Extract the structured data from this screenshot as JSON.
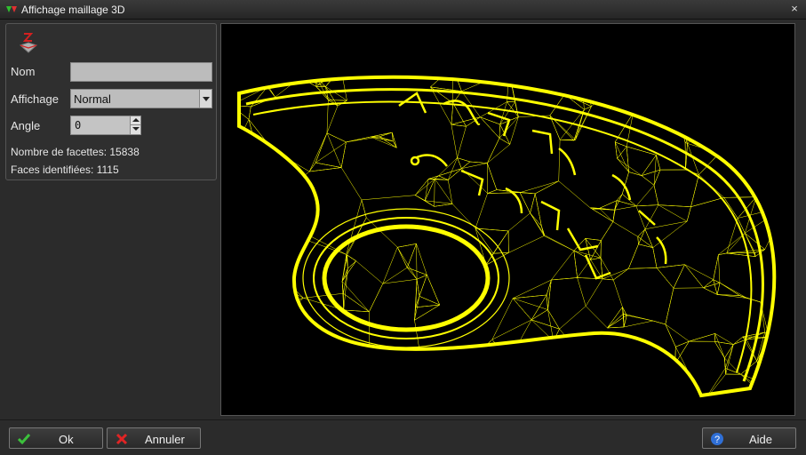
{
  "window": {
    "title": "Affichage maillage 3D",
    "close_symbol": "×"
  },
  "form": {
    "name_label": "Nom",
    "name_value": "",
    "display_label": "Affichage",
    "display_value": "Normal",
    "angle_label": "Angle",
    "angle_value": "0",
    "facets_text": "Nombre de facettes: 15838",
    "faces_text": "Faces identifiées: 1115"
  },
  "viewport": {
    "background": "#000000",
    "mesh_color": "#ffff00",
    "content": "wireframe-mesh"
  },
  "buttons": {
    "ok_label": "Ok",
    "cancel_label": "Annuler",
    "help_label": "Aide"
  },
  "colors": {
    "ok_icon": "#3cc13c",
    "cancel_icon": "#e02424",
    "help_icon": "#2f6fd6"
  }
}
